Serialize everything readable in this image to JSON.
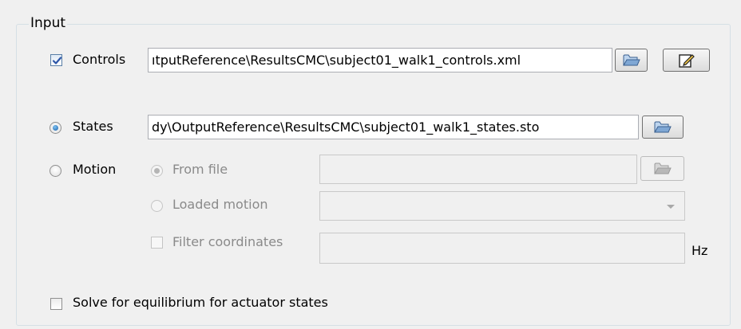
{
  "panel": {
    "legend": "Input"
  },
  "controls": {
    "label": "Controls",
    "checked": true,
    "path": "ıtputReference\\ResultsCMC\\subject01_walk1_controls.xml",
    "browse_icon": "folder-open-icon",
    "edit_icon": "edit-icon"
  },
  "states": {
    "label": "States",
    "selected": true,
    "path": "dy\\OutputReference\\ResultsCMC\\subject01_walk1_states.sto",
    "browse_icon": "folder-open-icon"
  },
  "motion": {
    "label": "Motion",
    "from_file_label": "From file",
    "from_file_path": "",
    "loaded_motion_label": "Loaded motion",
    "loaded_motion_value": "",
    "filter_label": "Filter coordinates",
    "filter_value": "",
    "filter_unit": "Hz"
  },
  "equilibrium": {
    "label": "Solve for equilibrium for actuator states",
    "checked": false
  }
}
